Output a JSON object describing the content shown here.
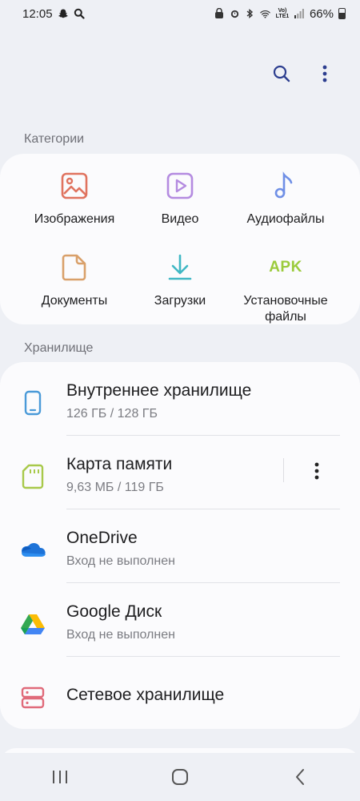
{
  "status_bar": {
    "time": "12:05",
    "network_top": "Vo)",
    "network_bottom": "LTE1",
    "battery": "66%"
  },
  "top_bar": {
    "icons": [
      "search-icon",
      "more-vert-icon"
    ]
  },
  "categories": {
    "title": "Категории",
    "items": [
      {
        "label": "Изображения",
        "icon": "image-icon",
        "color": "#e0735f"
      },
      {
        "label": "Видео",
        "icon": "video-icon",
        "color": "#b48be0"
      },
      {
        "label": "Аудиофайлы",
        "icon": "music-note-icon",
        "color": "#6f8fe6"
      },
      {
        "label": "Документы",
        "icon": "document-icon",
        "color": "#d9a06a"
      },
      {
        "label": "Загрузки",
        "icon": "download-icon",
        "color": "#3fb7c4"
      },
      {
        "label": "Установочные\nфайлы",
        "icon": "apk-icon",
        "text": "APK",
        "color": "#9bcb3c"
      }
    ]
  },
  "storage": {
    "title": "Хранилище",
    "items": [
      {
        "title": "Внутреннее хранилище",
        "subtitle": "126 ГБ / 128 ГБ",
        "icon": "phone-icon",
        "color": "#4a9ad8"
      },
      {
        "title": "Карта памяти",
        "subtitle": "9,63 МБ / 119 ГБ",
        "icon": "sd-card-icon",
        "color": "#a8c94a"
      },
      {
        "title": "OneDrive",
        "subtitle": "Вход не выполнен",
        "icon": "onedrive-icon",
        "color": "#1e73d8"
      },
      {
        "title": "Google Диск",
        "subtitle": "Вход не выполнен",
        "icon": "google-drive-icon"
      },
      {
        "title": "Сетевое хранилище",
        "subtitle": "",
        "icon": "network-storage-icon",
        "color": "#e06a7a"
      }
    ]
  },
  "nav_bar": {
    "icons": [
      "recent-apps-icon",
      "home-icon",
      "back-icon"
    ]
  }
}
